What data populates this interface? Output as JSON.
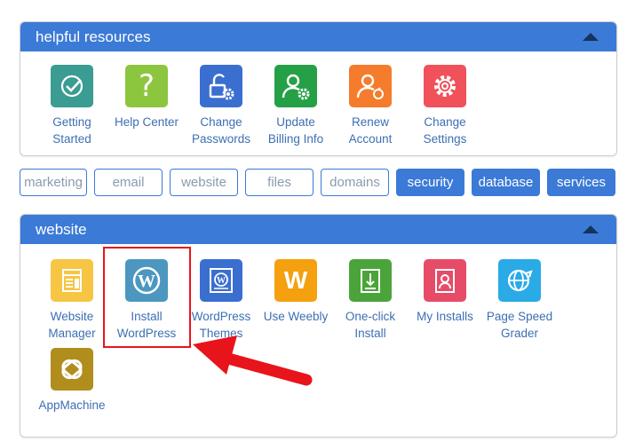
{
  "helpful_resources": {
    "title": "helpful resources",
    "items": [
      {
        "line1": "Getting",
        "line2": "Started",
        "icon": "checkmark-icon",
        "color": "#3a9c92"
      },
      {
        "line1": "Help Center",
        "line2": "",
        "icon": "question-mark-icon",
        "color": "#8cc63e"
      },
      {
        "line1": "Change",
        "line2": "Passwords",
        "icon": "lock-gear-icon",
        "color": "#3a6fd0"
      },
      {
        "line1": "Update",
        "line2": "Billing Info",
        "icon": "user-gear-icon",
        "color": "#26a046"
      },
      {
        "line1": "Renew",
        "line2": "Account",
        "icon": "user-refresh-icon",
        "color": "#f47c2c"
      },
      {
        "line1": "Change",
        "line2": "Settings",
        "icon": "gear-icon",
        "color": "#f0515b"
      }
    ]
  },
  "tabs": [
    {
      "label": "marketing",
      "active": false
    },
    {
      "label": "email",
      "active": false
    },
    {
      "label": "website",
      "active": false
    },
    {
      "label": "files",
      "active": false
    },
    {
      "label": "domains",
      "active": false
    },
    {
      "label": "security",
      "active": true
    },
    {
      "label": "database",
      "active": true
    },
    {
      "label": "services",
      "active": true
    }
  ],
  "website": {
    "title": "website",
    "items": [
      {
        "line1": "Website",
        "line2": "Manager",
        "icon": "layout-icon",
        "color": "#f7c544"
      },
      {
        "line1": "Install",
        "line2": "WordPress",
        "icon": "wordpress-icon",
        "color": "#4c97c0"
      },
      {
        "line1": "WordPress",
        "line2": "Themes",
        "icon": "wordpress-themes-icon",
        "color": "#3a6fd0"
      },
      {
        "line1": "Use Weebly",
        "line2": "",
        "icon": "weebly-icon",
        "color": "#f5a00f"
      },
      {
        "line1": "One-click",
        "line2": "Install",
        "icon": "one-click-install-icon",
        "color": "#4ba43a"
      },
      {
        "line1": "My Installs",
        "line2": "",
        "icon": "my-installs-icon",
        "color": "#e64c68"
      },
      {
        "line1": "Page Speed",
        "line2": "Grader",
        "icon": "globe-icon",
        "color": "#2aaae6"
      },
      {
        "line1": "AppMachine",
        "line2": "",
        "icon": "appmachine-icon",
        "color": "#b08d1d"
      }
    ]
  },
  "annotation": {
    "highlight_color": "#e8141b",
    "arrow_color": "#e8141b"
  }
}
